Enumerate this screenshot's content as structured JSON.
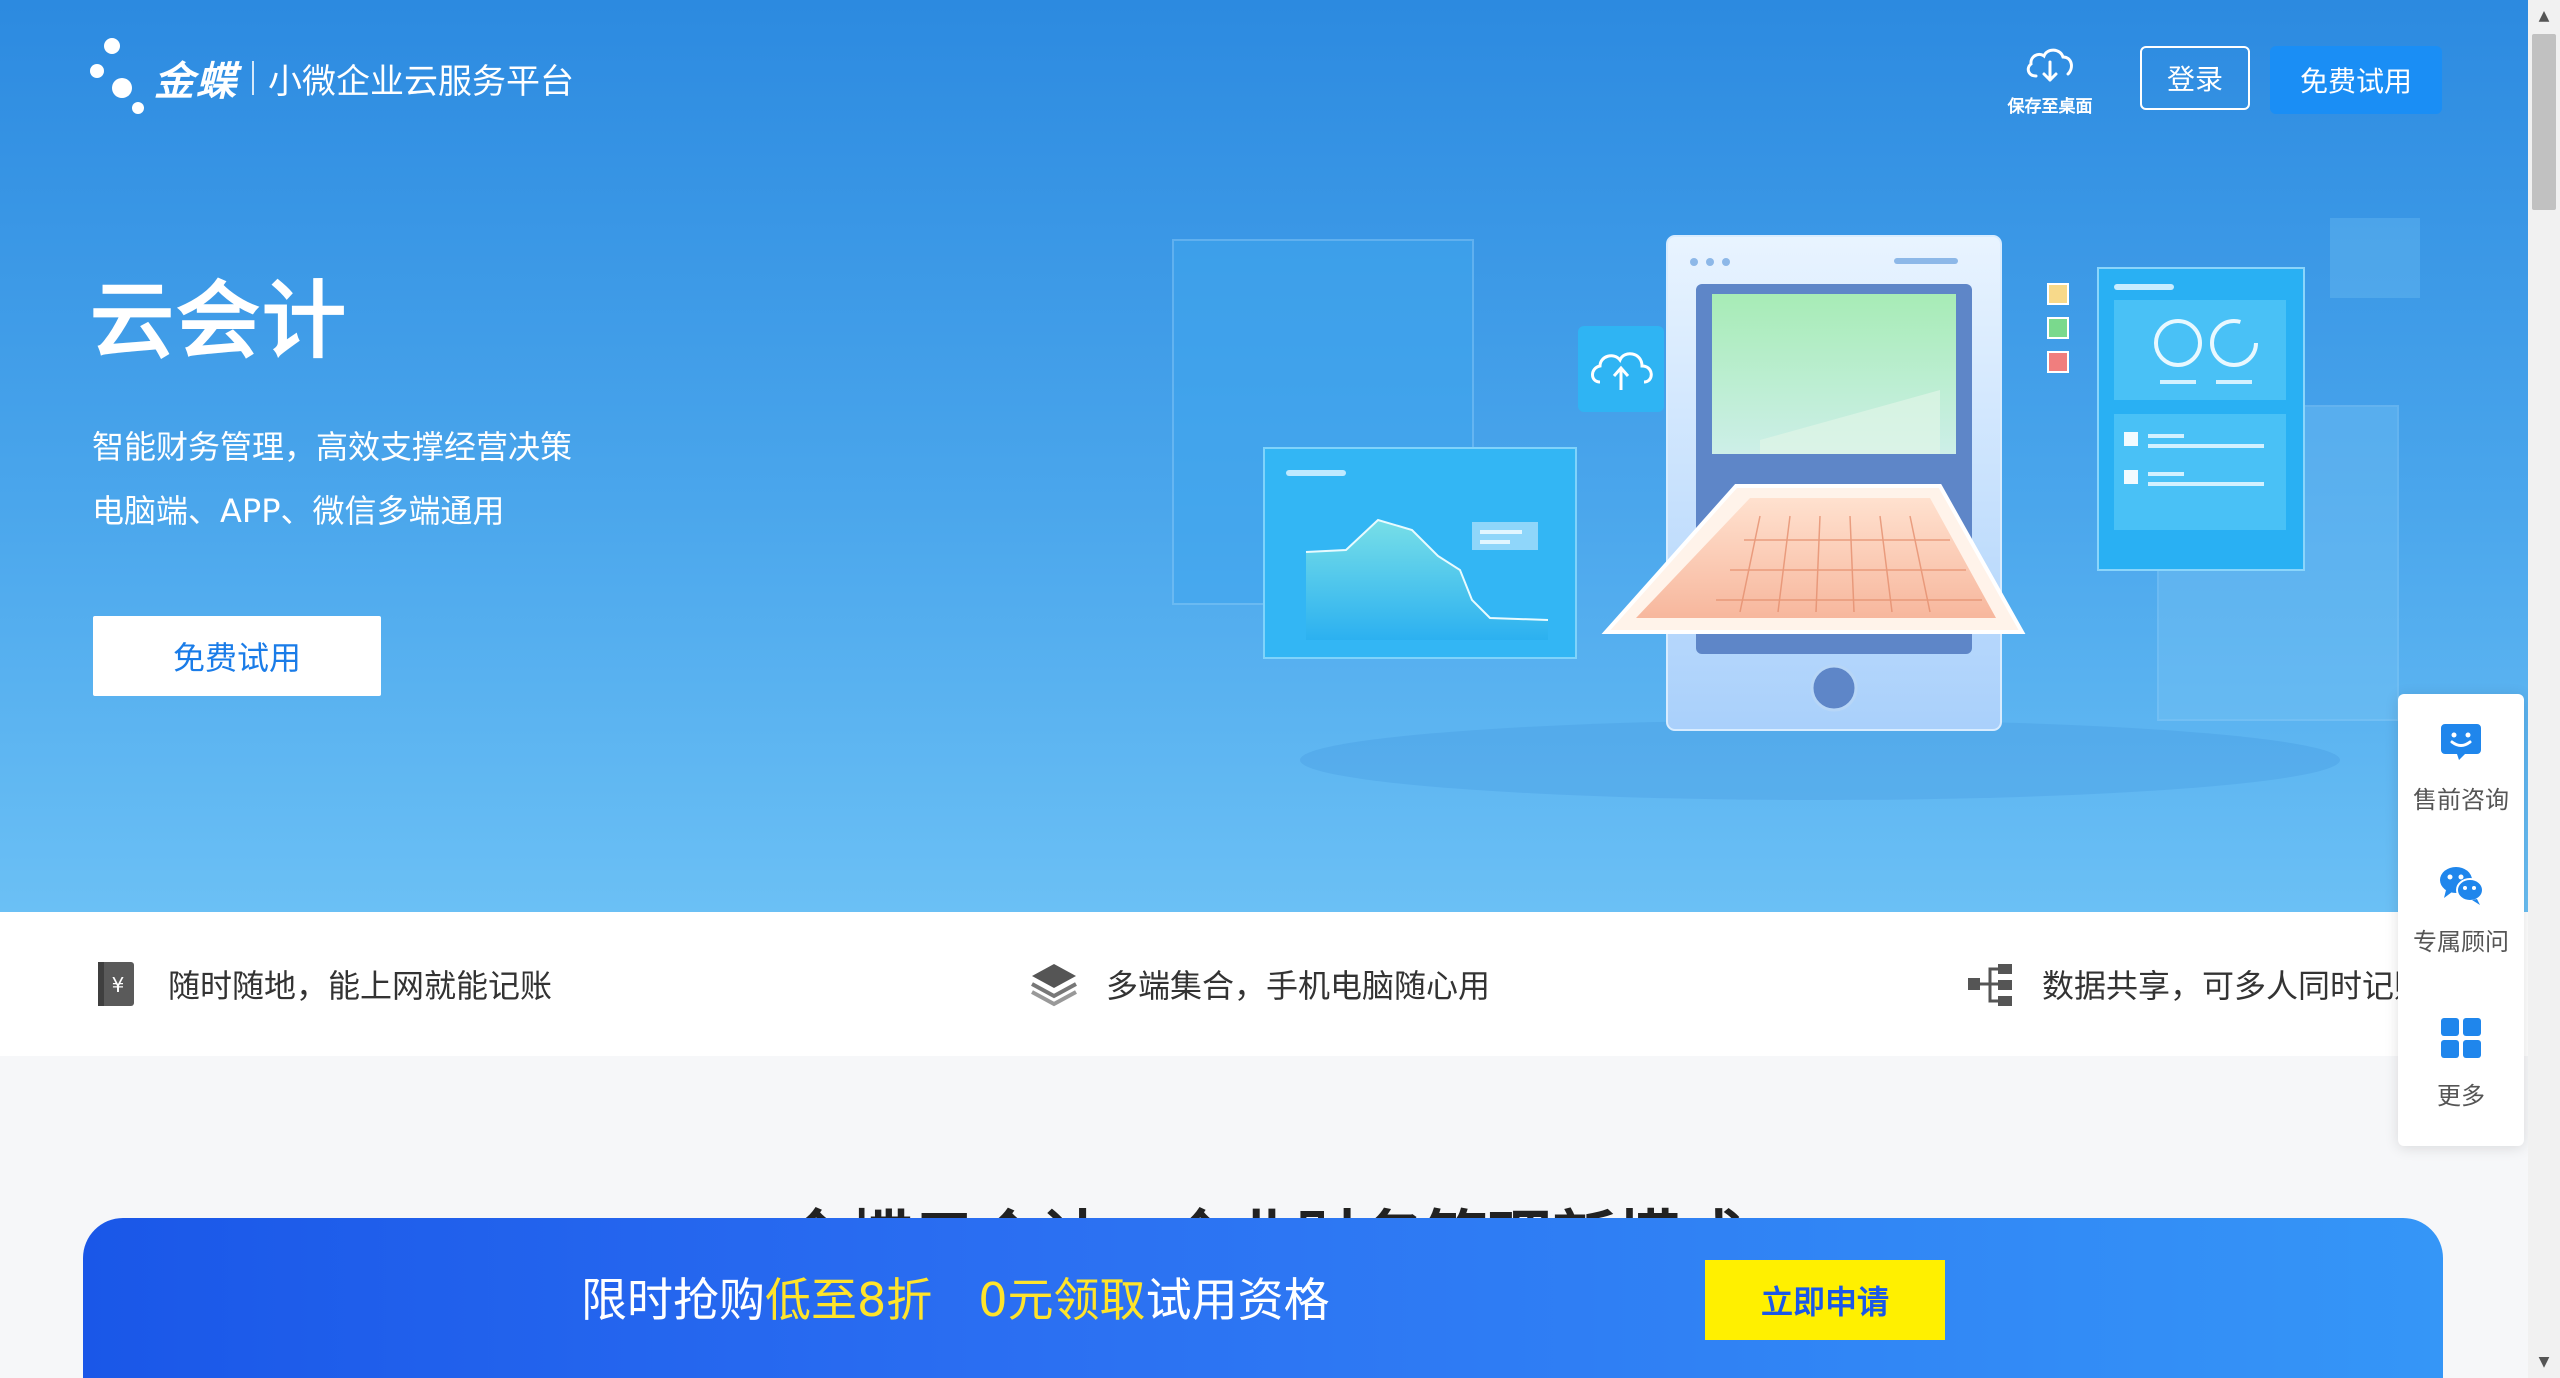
{
  "header": {
    "brand": "金蝶",
    "tagline": "小微企业云服务平台",
    "save_to_desktop": "保存至桌面",
    "login": "登录",
    "free_trial": "免费试用"
  },
  "hero": {
    "title": "云会计",
    "line1": "智能财务管理，高效支撑经营决策",
    "line2": "电脑端、APP、微信多端通用",
    "cta": "免费试用"
  },
  "features": [
    {
      "text": "随时随地，能上网就能记账",
      "icon": "yen-icon"
    },
    {
      "text": "多端集合，手机电脑随心用",
      "icon": "layers-icon"
    },
    {
      "text": "数据共享，可多人同时记账",
      "icon": "share-icon"
    }
  ],
  "section": {
    "heading": "金蝶云会计，企业财务管理新模式"
  },
  "promo": {
    "part1": "限时抢购",
    "part2": "低至8折",
    "part3": "0元领取",
    "part4": "试用资格",
    "button": "立即申请"
  },
  "float_bar": {
    "items": [
      {
        "label": "售前咨询",
        "icon": "chat-icon"
      },
      {
        "label": "专属顾问",
        "icon": "wechat-icon"
      },
      {
        "label": "更多",
        "icon": "grid-icon"
      }
    ]
  },
  "colors": {
    "hero_top": "#2c8ae0",
    "hero_bottom": "#6bc0f5",
    "accent": "#1a8ef5",
    "promo_highlight": "#ffe42a",
    "promo_button": "#fff000"
  }
}
